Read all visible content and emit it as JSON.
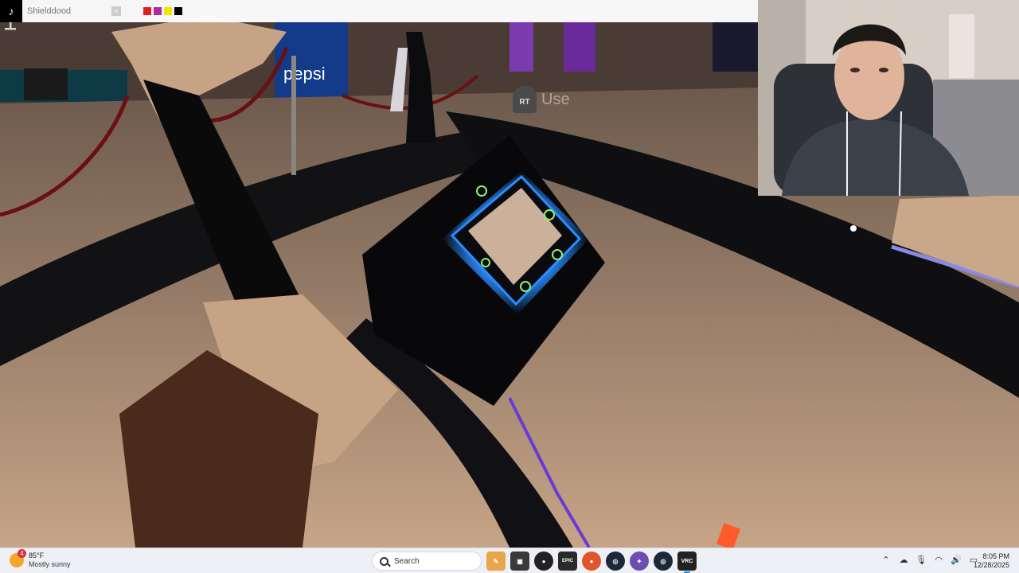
{
  "overlay": {
    "platform_icon": "tiktok-icon",
    "username": "Shielddood",
    "swatches": [
      "#e01e24",
      "#b2279c",
      "#f2e600",
      "#000000"
    ]
  },
  "game": {
    "prompt_button": "RT",
    "prompt_action": "Use",
    "sign_text": "pepsi",
    "mic_icon": "microphone-icon"
  },
  "taskbar": {
    "weather": {
      "temp": "85°F",
      "condition": "Mostly sunny",
      "badge": "4"
    },
    "search_placeholder": "Search",
    "apps": [
      "start-icon",
      "search-box",
      "copilot-icon",
      "file-explorer-icon",
      "obs-icon",
      "epic-games-icon",
      "firefox-icon",
      "steam-icon",
      "app-icon",
      "steam-icon",
      "vrchat-icon"
    ],
    "vrc_label": "VRC",
    "epic_label": "EPIC",
    "time": "8:05 PM",
    "date": "12/28/2025"
  },
  "colors": {
    "windows_blue": "#1f86e0",
    "phone_glow": "#2a8cff",
    "game_sand": "#c9a88a",
    "game_dark": "#0f0f12"
  }
}
